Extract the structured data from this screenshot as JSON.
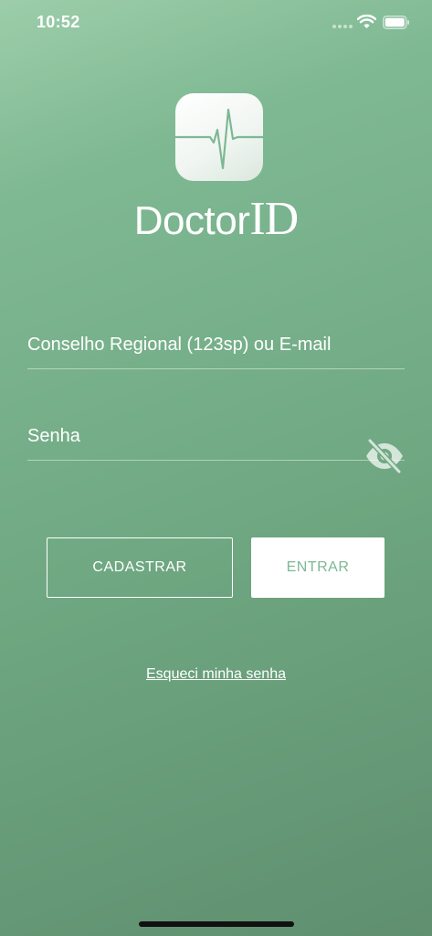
{
  "status_bar": {
    "time": "10:52",
    "wifi_icon": "wifi-icon",
    "battery_icon": "battery-icon"
  },
  "app": {
    "icon": "heartbeat-icon",
    "brand_doctor": "Doctor",
    "brand_id": "ID"
  },
  "form": {
    "email": {
      "placeholder": "Conselho Regional (123sp) ou E-mail",
      "value": ""
    },
    "password": {
      "placeholder": "Senha",
      "value": "",
      "visibility_icon": "eye-off-icon"
    }
  },
  "actions": {
    "register_label": "CADASTRAR",
    "login_label": "ENTRAR",
    "forgot_label": "Esqueci minha senha"
  },
  "colors": {
    "background_top": "#9dcdaa",
    "background_bottom": "#5f8f6f",
    "accent": "#7db894",
    "text": "#ffffff"
  }
}
